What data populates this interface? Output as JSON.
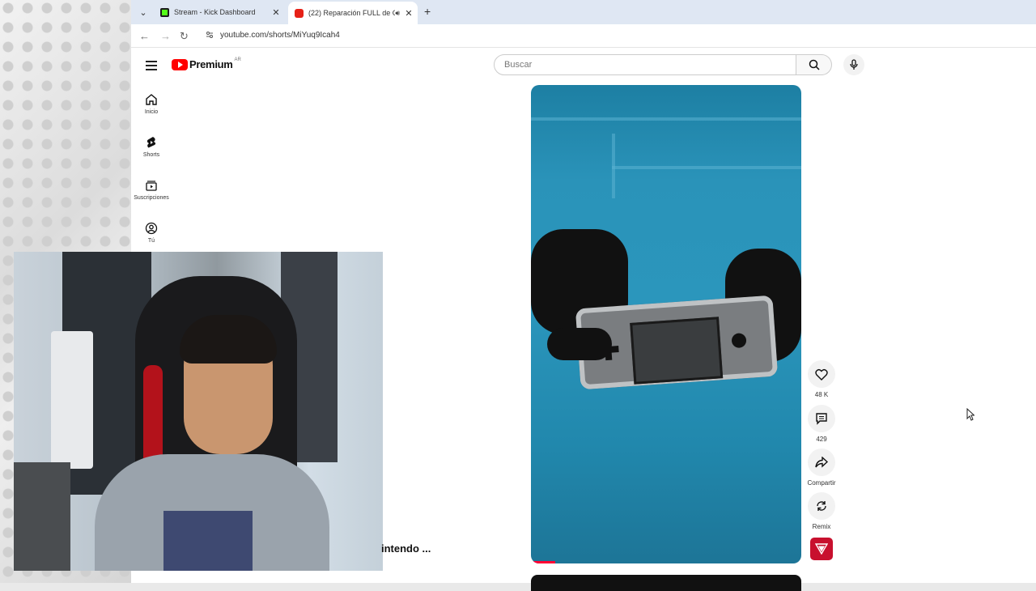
{
  "browser": {
    "tabs": [
      {
        "title": "Stream - Kick Dashboard",
        "favicon": "kick-favicon",
        "active": false
      },
      {
        "title": "(22) Reparación FULL de Ga",
        "favicon": "youtube-favicon",
        "active": true
      }
    ],
    "url": "youtube.com/shorts/MiYuq9Icah4"
  },
  "youtube": {
    "logo_text": "Premium",
    "country_code": "AR",
    "search_placeholder": "Buscar",
    "sidebar": [
      {
        "label": "Inicio",
        "icon": "home-icon"
      },
      {
        "label": "Shorts",
        "icon": "shorts-icon"
      },
      {
        "label": "Suscripciones",
        "icon": "subscriptions-icon"
      },
      {
        "label": "Tú",
        "icon": "you-icon"
      }
    ],
    "actions": {
      "likes": "48 K",
      "comments": "429",
      "share": "Compartir",
      "remix": "Remix"
    },
    "title_fragment": "intendo ..."
  },
  "colors": {
    "accent": "#ff0000",
    "tab_bar": "#dfe7f3",
    "video_mat": "#2b96bc"
  }
}
